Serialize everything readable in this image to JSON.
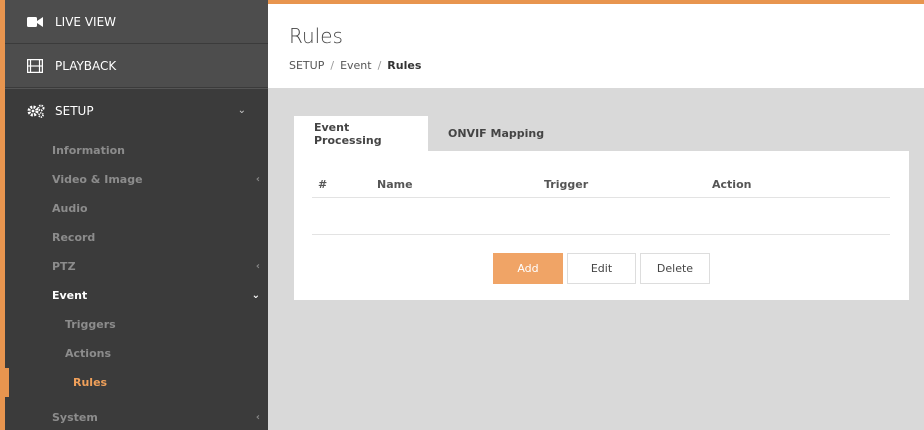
{
  "sidebar": {
    "live_view": "LIVE VIEW",
    "playback": "PLAYBACK",
    "setup": "SETUP",
    "items": [
      {
        "label": "Information"
      },
      {
        "label": "Video & Image"
      },
      {
        "label": "Audio"
      },
      {
        "label": "Record"
      },
      {
        "label": "PTZ"
      },
      {
        "label": "Event"
      },
      {
        "label": "Triggers"
      },
      {
        "label": "Actions"
      },
      {
        "label": "Rules"
      },
      {
        "label": "System"
      }
    ]
  },
  "header": {
    "title": "Rules",
    "breadcrumb": [
      "SETUP",
      "Event",
      "Rules"
    ]
  },
  "tabs": [
    {
      "label": "Event Processing"
    },
    {
      "label": "ONVIF Mapping"
    }
  ],
  "table": {
    "columns": [
      "#",
      "Name",
      "Trigger",
      "Action"
    ]
  },
  "buttons": {
    "add": "Add",
    "edit": "Edit",
    "delete": "Delete"
  },
  "colors": {
    "accent": "#e8954f",
    "sidebar_bg": "#3b3b3b"
  }
}
